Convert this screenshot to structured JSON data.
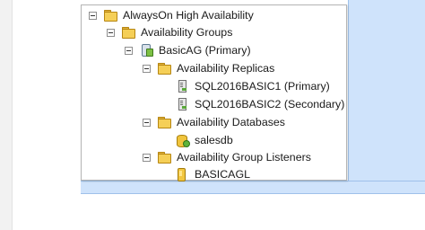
{
  "tree": {
    "root": {
      "label": "AlwaysOn High Availability",
      "icon": "folder-icon"
    },
    "availability_groups": {
      "label": "Availability Groups",
      "icon": "folder-icon"
    },
    "group": {
      "label": "BasicAG (Primary)",
      "icon": "availability-group-icon"
    },
    "replicas_folder": {
      "label": "Availability Replicas",
      "icon": "folder-icon"
    },
    "replicas": [
      {
        "label": "SQL2016BASIC1 (Primary)",
        "icon": "replica-server-icon"
      },
      {
        "label": "SQL2016BASIC2 (Secondary)",
        "icon": "replica-server-icon"
      }
    ],
    "databases_folder": {
      "label": "Availability Databases",
      "icon": "folder-icon"
    },
    "databases": [
      {
        "label": "salesdb",
        "icon": "database-icon"
      }
    ],
    "listeners_folder": {
      "label": "Availability Group Listeners",
      "icon": "folder-icon"
    },
    "listeners": [
      {
        "label": "BASICAGL",
        "icon": "listener-icon"
      }
    ]
  },
  "colors": {
    "selection_panel": "#cfe3fb",
    "panel_border": "#9fc1ea",
    "folder": "#f5cf57"
  }
}
